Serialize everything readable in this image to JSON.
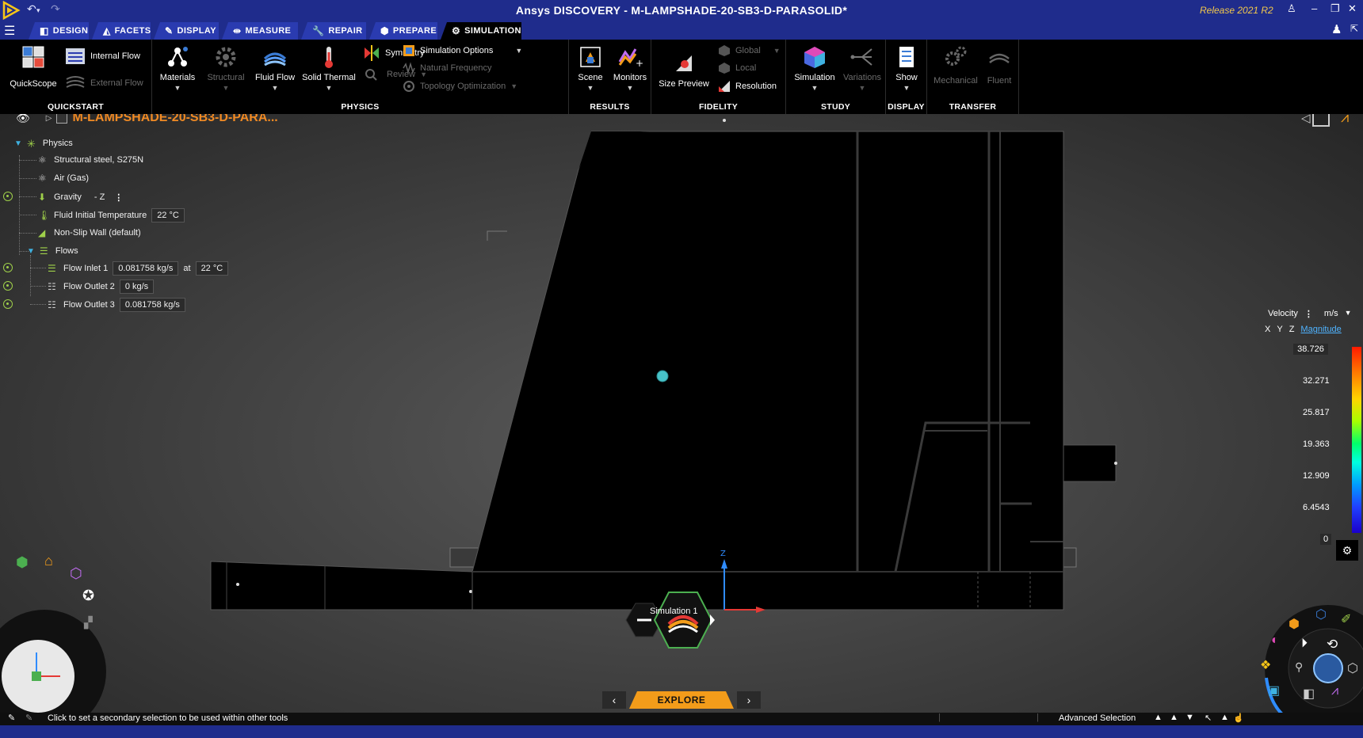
{
  "window": {
    "title": "Ansys DISCOVERY - M-LAMPSHADE-20-SB3-D-PARASOLID*",
    "release": "Release 2021 R2"
  },
  "tabs": [
    {
      "label": "Design",
      "icon": "design-icon"
    },
    {
      "label": "Facets",
      "icon": "facets-icon"
    },
    {
      "label": "Display",
      "icon": "display-icon"
    },
    {
      "label": "Measure",
      "icon": "measure-icon"
    },
    {
      "label": "Repair",
      "icon": "repair-icon"
    },
    {
      "label": "Prepare",
      "icon": "prepare-icon"
    },
    {
      "label": "Simulation",
      "icon": "simulation-icon",
      "active": true
    }
  ],
  "ribbon": {
    "quickstart": {
      "label": "QuickStart",
      "quickscope": "QuickScope",
      "internal_flow": "Internal Flow",
      "external_flow": "External Flow"
    },
    "physics": {
      "label": "Physics",
      "materials": "Materials",
      "structural": "Structural",
      "fluid_flow": "Fluid Flow",
      "solid_thermal": "Solid Thermal",
      "symmetry": "Symmetry",
      "review": "Review",
      "simulation_options": "Simulation Options",
      "natural_frequency": "Natural Frequency",
      "topology_optimization": "Topology Optimization"
    },
    "results": {
      "label": "Results",
      "scene": "Scene",
      "monitors": "Monitors"
    },
    "fidelity": {
      "label": "Fidelity",
      "size_preview": "Size Preview",
      "global": "Global",
      "local": "Local",
      "resolution": "Resolution"
    },
    "study": {
      "label": "Study",
      "simulation": "Simulation",
      "variations": "Variations"
    },
    "display": {
      "label": "Display",
      "show": "Show"
    },
    "transfer": {
      "label": "Transfer",
      "mechanical": "Mechanical",
      "fluent": "Fluent"
    }
  },
  "tree": {
    "root": "M-LAMPSHADE-20-SB3-D-PARA...",
    "physics": "Physics",
    "items": [
      {
        "label": "Structural steel, S275N"
      },
      {
        "label": "Air (Gas)"
      },
      {
        "label": "Gravity",
        "value": "- Z"
      },
      {
        "label": "Fluid Initial Temperature",
        "value": "22 °C"
      },
      {
        "label": "Non-Slip Wall (default)"
      }
    ],
    "flows": {
      "label": "Flows",
      "inlet1": {
        "label": "Flow Inlet 1",
        "rate": "0.081758 kg/s",
        "at": "at",
        "temp": "22 °C"
      },
      "outlet2": {
        "label": "Flow Outlet 2",
        "rate": "0 kg/s"
      },
      "outlet3": {
        "label": "Flow Outlet 3",
        "rate": "0.081758 kg/s"
      }
    }
  },
  "legend": {
    "quantity": "Velocity",
    "unit": "m/s",
    "axis_x": "X",
    "axis_y": "Y",
    "axis_z": "Z",
    "component": "Magnitude",
    "values": [
      "38.726",
      "32.271",
      "25.817",
      "19.363",
      "12.909",
      "6.4543",
      "0"
    ],
    "colors": {
      "max": "#ff1a00",
      "min": "#1a00cc"
    }
  },
  "viewport": {
    "simulation_label": "Simulation 1",
    "triad_z": "Z"
  },
  "explore": {
    "label": "Explore"
  },
  "status": {
    "message": "Click to set a secondary selection to be used within other tools",
    "advanced_selection": "Advanced Selection"
  },
  "colors": {
    "title_bar": "#1f2c8c",
    "tab": "#2a3bb0",
    "accent_orange": "#f39c1a",
    "tree_root": "#f08a24"
  }
}
